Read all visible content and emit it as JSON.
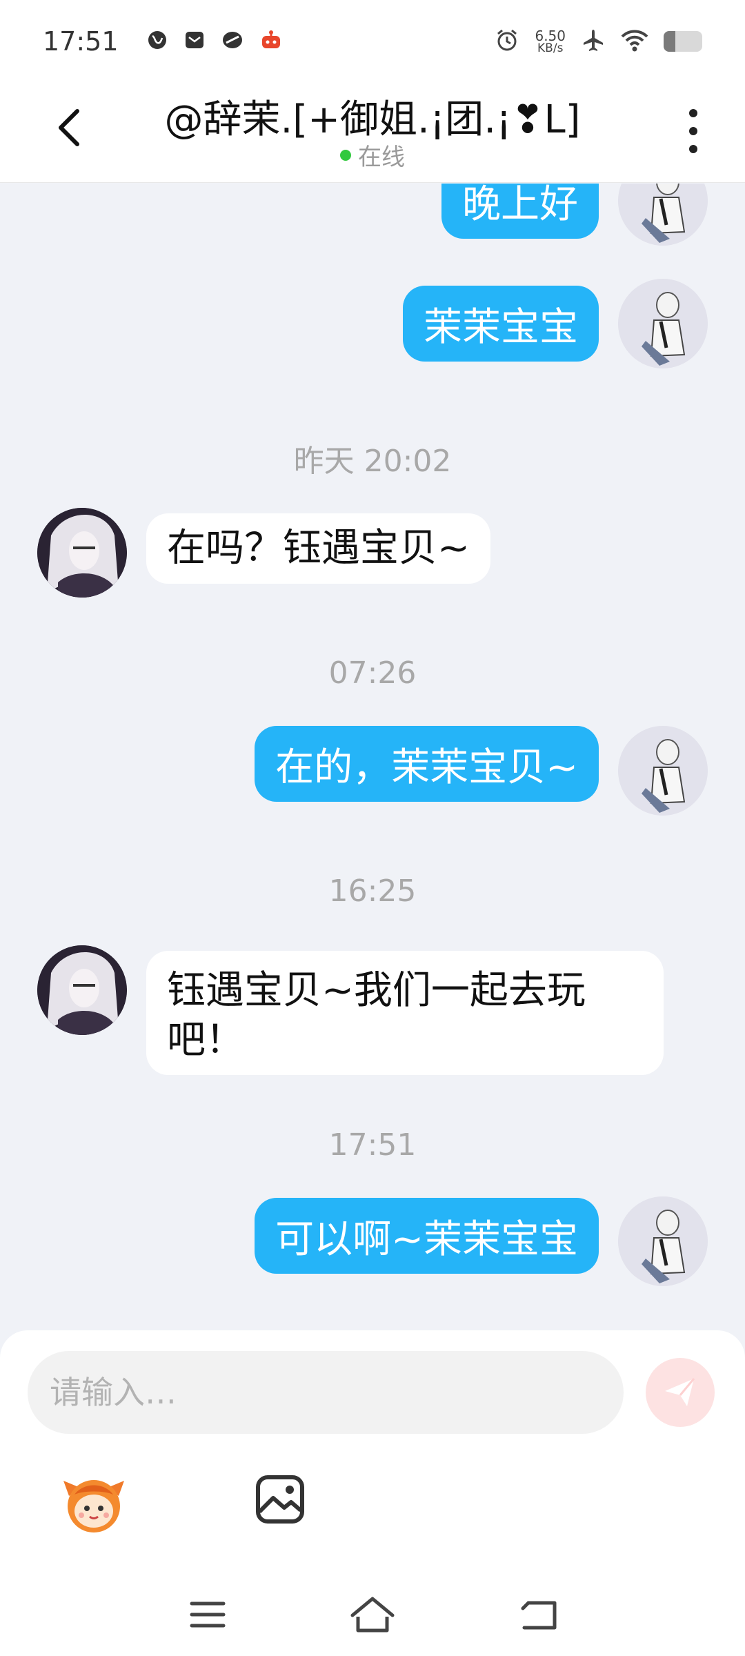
{
  "status_bar": {
    "time": "17:51",
    "net_speed_value": "6.50",
    "net_speed_unit": "KB/s",
    "battery_level": 0.3,
    "left_icons": [
      "globe-icon",
      "mail-icon",
      "app-icon",
      "robot-icon"
    ],
    "right_icons": [
      "alarm-icon",
      "airplane-icon",
      "wifi-icon",
      "battery-icon"
    ]
  },
  "header": {
    "title": "@辞茉.[+御姐.¡团.¡❣L]",
    "presence": "在线",
    "presence_color": "#31c93e"
  },
  "messages": [
    {
      "from": "self",
      "text": "晚上好"
    },
    {
      "from": "self",
      "text": "茉茉宝宝"
    },
    {
      "type": "timestamp",
      "text": "昨天 20:02"
    },
    {
      "from": "other",
      "text": "在吗？钰遇宝贝~"
    },
    {
      "type": "timestamp",
      "text": "07:26"
    },
    {
      "from": "self",
      "text": "在的，茉茉宝贝~"
    },
    {
      "type": "timestamp",
      "text": "16:25"
    },
    {
      "from": "other",
      "text": "钰遇宝贝~我们一起去玩吧！"
    },
    {
      "type": "timestamp",
      "text": "17:51"
    },
    {
      "from": "self",
      "text": "可以啊~茉茉宝宝"
    }
  ],
  "composer": {
    "placeholder": "请输入…",
    "value": "",
    "tools": [
      "sticker-icon",
      "image-icon"
    ]
  },
  "theme": {
    "accent": "#25b4f8",
    "background": "#f0f2f7",
    "send_button": "#fde2e2"
  },
  "nav_bar": [
    "menu-icon",
    "home-icon",
    "back-icon"
  ]
}
